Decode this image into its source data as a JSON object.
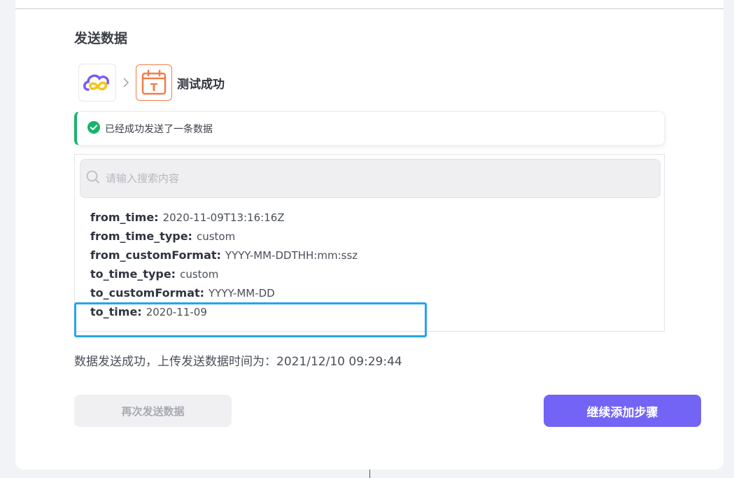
{
  "section": {
    "title": "发送数据"
  },
  "apps": {
    "source_icon": "cloud-logo-icon",
    "target_icon": "calendar-t-icon",
    "target_letter": "T",
    "test_status": "测试成功"
  },
  "alert": {
    "message": "已经成功发送了一条数据"
  },
  "search": {
    "placeholder": "请输入搜索内容"
  },
  "fields": [
    {
      "key": "from_time:",
      "value": "2020-11-09T13:16:16Z"
    },
    {
      "key": "from_time_type:",
      "value": "custom"
    },
    {
      "key": "from_customFormat:",
      "value": "YYYY-MM-DDTHH:mm:ssz"
    },
    {
      "key": "to_time_type:",
      "value": "custom"
    },
    {
      "key": "to_customFormat:",
      "value": "YYYY-MM-DD"
    },
    {
      "key": "to_time:",
      "value": "2020-11-09"
    }
  ],
  "upload_info": "数据发送成功，上传发送数据时间为：2021/12/10 09:29:44",
  "buttons": {
    "resend": "再次发送数据",
    "continue": "继续添加步骤"
  },
  "colors": {
    "success": "#1ab36a",
    "primary": "#7364f6",
    "highlight": "#27a3ee",
    "orange": "#f07d4a"
  }
}
